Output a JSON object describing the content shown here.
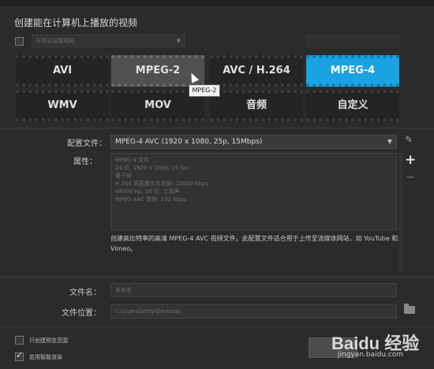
{
  "heading": "创建能在计算机上播放的视频",
  "preset": {
    "placeholder": "与项目设置相同"
  },
  "formats": {
    "row1": [
      "AVI",
      "MPEG-2",
      "AVC / H.264",
      "MPEG-4"
    ],
    "row2": [
      "WMV",
      "MOV",
      "音频",
      "自定义"
    ],
    "selected": "MPEG-4",
    "hovered": "MPEG-2"
  },
  "tooltip": "MPEG-2",
  "profile": {
    "label": "配置文件：",
    "value": "MPEG-4 AVC (1920 x 1080, 25p, 15Mbps)"
  },
  "properties": {
    "label": "属性：",
    "lines": [
      "MPEG-4 文件",
      "24 位, 1920 x 1080, 25 fps",
      "基于帧",
      "H.264 高配置文件视频: 15000 Kbps",
      "48000 Hz, 16 位, 立体声",
      "MPEG AAC 音频: 192 Kbps"
    ]
  },
  "description": "创建高比特率的高清 MPEG-4 AVC 视频文件。此配置文件适合用于上传至流媒体网站，如 YouTube 和 Vimeo。",
  "filename": {
    "label": "文件名：",
    "value": "未命名"
  },
  "location": {
    "label": "文件位置：",
    "value": "C:\\Users\\betty\\Desktop\\"
  },
  "options": {
    "preview_only": "只创建预览范围",
    "smart_render": "启用智能渲染"
  },
  "watermark": {
    "brand": "Baidu 经验",
    "url": "jingyan.baidu.com"
  },
  "colors": {
    "accent": "#1aa2e2",
    "background": "#2b2b2b"
  }
}
